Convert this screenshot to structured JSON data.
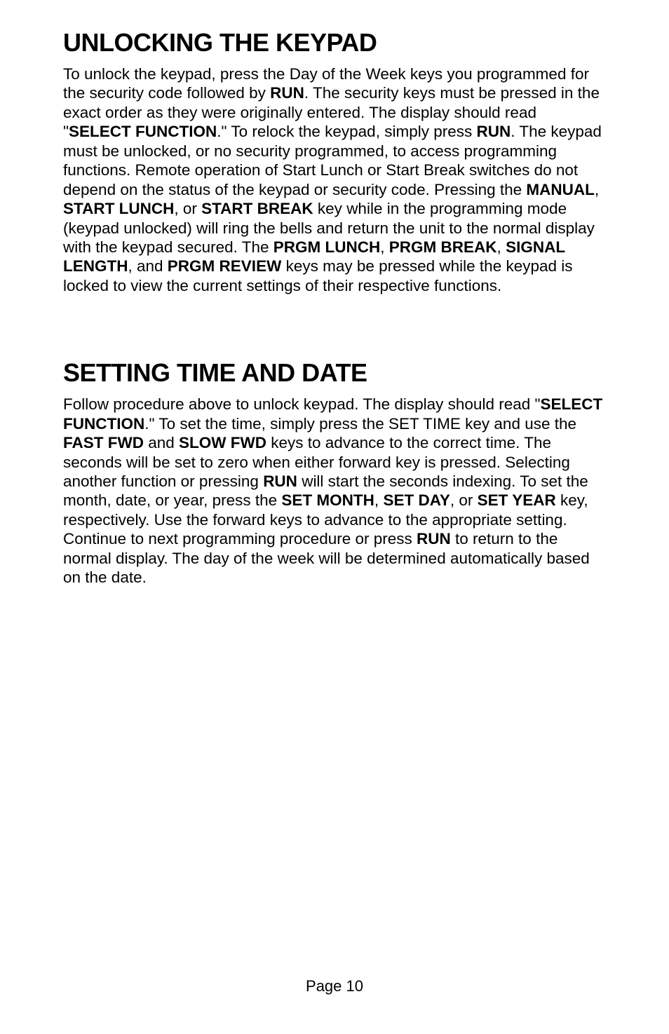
{
  "section1": {
    "heading": "UNLOCKING THE KEYPAD",
    "p1a": "To unlock the keypad, press the Day of the Week keys you programmed for the security code followed by ",
    "run1": "RUN",
    "p1b": ".  The security keys must be pressed in the exact order as they were originally entered.  The display should read \"",
    "select_function": "SELECT FUNCTION",
    "p1c": ".\"  To relock the keypad, simply press ",
    "run2": "RUN",
    "p1d": ".  The keypad must be unlocked, or no security programmed, to access programming functions.  Remote operation of Start Lunch or Start Break switches do not depend on the status of the keypad or security code.  Pressing the ",
    "manual": "MANUAL",
    "comma1": ", ",
    "start_lunch": "START LUNCH",
    "or1": ", or ",
    "start_break": "START BREAK",
    "p1e": " key while in the programming mode (keypad unlocked) will ring the bells and return the unit to the normal display with the keypad secured.  The ",
    "prgm_lunch": "PRGM LUNCH",
    "comma2": ", ",
    "prgm_break": "PRGM BREAK",
    "comma3": ", ",
    "signal_length": "SIGNAL LENGTH",
    "and1": ", and ",
    "prgm_review": "PRGM REVIEW",
    "p1f": " keys may be pressed while the keypad is locked to view the current settings of their respective functions."
  },
  "section2": {
    "heading": "SETTING TIME AND DATE",
    "p2a": "Follow procedure above to unlock keypad.  The display should read \"",
    "select_function": "SELECT FUNCTION",
    "p2b": ".\"  To set the time, simply press the SET TIME key and use the ",
    "fast_fwd": "FAST FWD",
    "and2": " and ",
    "slow_fwd": "SLOW FWD",
    "p2c": " keys to advance to the correct time. The seconds will be set to zero when either forward key is pressed.  Selecting another function or pressing ",
    "run3": "RUN",
    "p2d": " will start the seconds indexing.  To set the month, date, or year, press the ",
    "set_month": "SET MONTH",
    "comma4": ", ",
    "set_day": "SET DAY",
    "or2": ", or ",
    "set_year": "SET YEAR",
    "p2e": " key, respectively.  Use the forward keys to advance to the appropriate setting.  Continue to next programming procedure or press ",
    "run4": "RUN",
    "p2f": " to return to the normal display.  The day of the week will be determined automatically based on the date."
  },
  "footer": "Page 10"
}
